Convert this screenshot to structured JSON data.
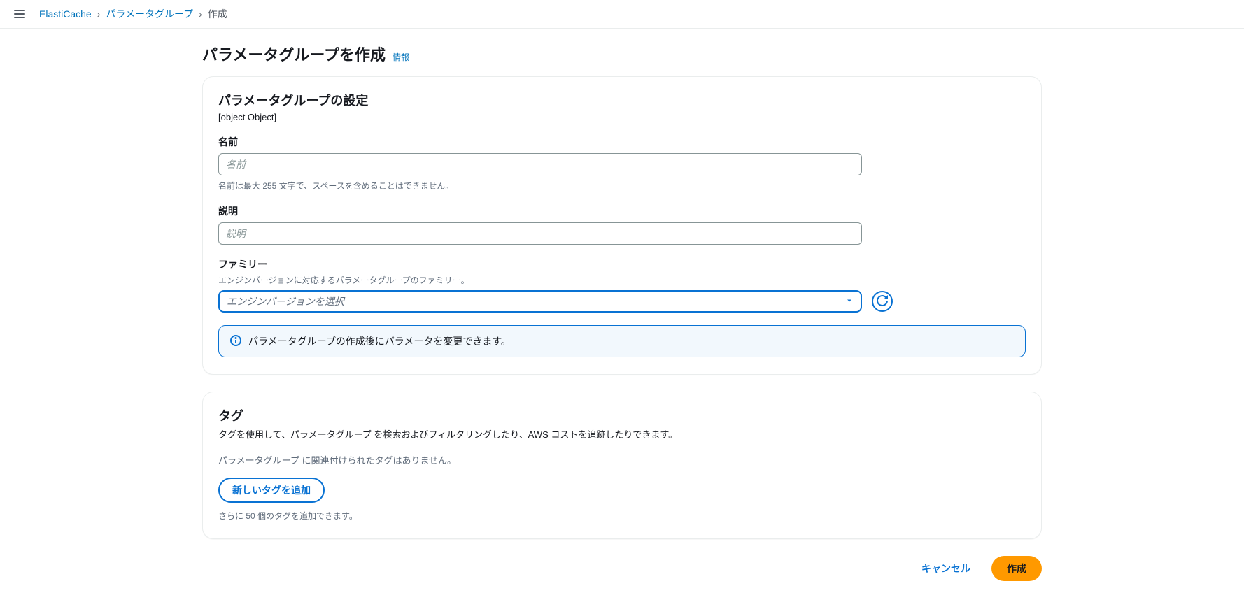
{
  "breadcrumb": {
    "items": [
      {
        "label": "ElastiCache",
        "link": true
      },
      {
        "label": "パラメータグループ",
        "link": true
      },
      {
        "label": "作成",
        "link": false
      }
    ]
  },
  "header": {
    "title": "パラメータグループを作成",
    "info_label": "情報"
  },
  "settings_panel": {
    "title": "パラメータグループの設定",
    "description": {
      "label": "説明",
      "placeholder": "説明",
      "value": ""
    },
    "name": {
      "label": "名前",
      "placeholder": "名前",
      "value": "",
      "hint": "名前は最大 255 文字で、スペースを含めることはできません。"
    },
    "family": {
      "label": "ファミリー",
      "sublabel": "エンジンバージョンに対応するパラメータグループのファミリー。",
      "placeholder": "エンジンバージョンを選択",
      "value": ""
    },
    "alert_text": "パラメータグループの作成後にパラメータを変更できます。"
  },
  "tags_panel": {
    "title": "タグ",
    "description": "タグを使用して、パラメータグループ を検索およびフィルタリングしたり、AWS コストを追跡したりできます。",
    "empty_text": "パラメータグループ に関連付けられたタグはありません。",
    "add_button_label": "新しいタグを追加",
    "remaining_hint": "さらに 50 個のタグを追加できます。"
  },
  "footer": {
    "cancel_label": "キャンセル",
    "create_label": "作成"
  }
}
